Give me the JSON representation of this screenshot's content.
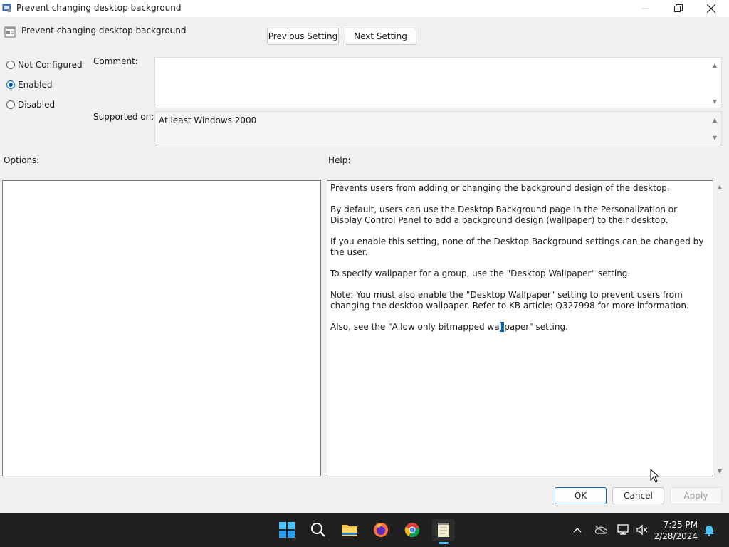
{
  "window": {
    "title": "Prevent changing desktop background",
    "controls": [
      "minimize",
      "restore",
      "close"
    ]
  },
  "header": {
    "setting_name": "Prevent changing desktop background",
    "prev_label": "Previous Setting",
    "next_label": "Next Setting"
  },
  "state": {
    "options": [
      {
        "label": "Not Configured",
        "selected": false
      },
      {
        "label": "Enabled",
        "selected": true
      },
      {
        "label": "Disabled",
        "selected": false
      }
    ]
  },
  "comment": {
    "label": "Comment:",
    "value": ""
  },
  "supported": {
    "label": "Supported on:",
    "value": "At least Windows 2000"
  },
  "options_label": "Options:",
  "help": {
    "label": "Help:",
    "paragraphs": [
      "Prevents users from adding or changing the background design of the desktop.",
      "By default, users can use the Desktop Background page in the Personalization or Display Control Panel to add a background design (wallpaper) to their desktop.",
      "If you enable this setting, none of the Desktop Background settings can be changed by the user.",
      "To specify wallpaper for a group, use the \"Desktop Wallpaper\" setting.",
      "Note: You must also enable the \"Desktop Wallpaper\" setting to prevent users from changing the desktop wallpaper. Refer to KB article: Q327998 for more information."
    ],
    "last_before": "Also, see the \"Allow only bitmapped wa",
    "last_selected": "ll",
    "last_after": "paper\" setting."
  },
  "footer": {
    "ok_label": "OK",
    "cancel_label": "Cancel",
    "apply_label": "Apply"
  },
  "taskbar": {
    "apps": [
      "start-icon",
      "search-icon",
      "file-explorer-icon",
      "firefox-icon",
      "chrome-icon",
      "notepad-icon"
    ],
    "time": "7:25 PM",
    "date": "2/28/2024"
  },
  "colors": {
    "accent": "#005fb8",
    "taskbar": "#202020",
    "dialog": "#f0f0f0"
  }
}
